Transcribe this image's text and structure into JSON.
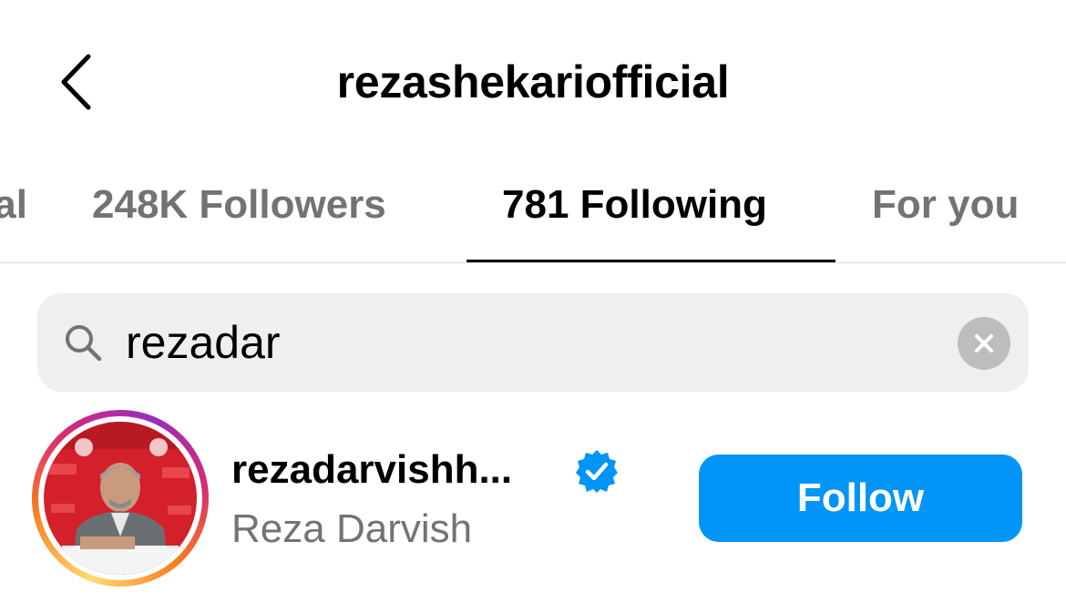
{
  "header": {
    "title": "rezashekariofficial",
    "back_icon": "chevron-left-icon"
  },
  "tabs": [
    {
      "label": "al",
      "active": false
    },
    {
      "label": "248K Followers",
      "active": false
    },
    {
      "label": "781 Following",
      "active": true
    },
    {
      "label": "For you",
      "active": false
    }
  ],
  "search": {
    "value": "rezadar",
    "icon": "search-icon",
    "clear_icon": "clear-icon"
  },
  "results": [
    {
      "username": "rezadarvishh...",
      "full_name": "Reza Darvish",
      "verified": true,
      "story_ring": true,
      "action_label": "Follow"
    }
  ],
  "colors": {
    "follow_button": "#0095f6",
    "verified_badge": "#0095f6",
    "secondary_text": "#737373",
    "search_background": "#efefef"
  }
}
